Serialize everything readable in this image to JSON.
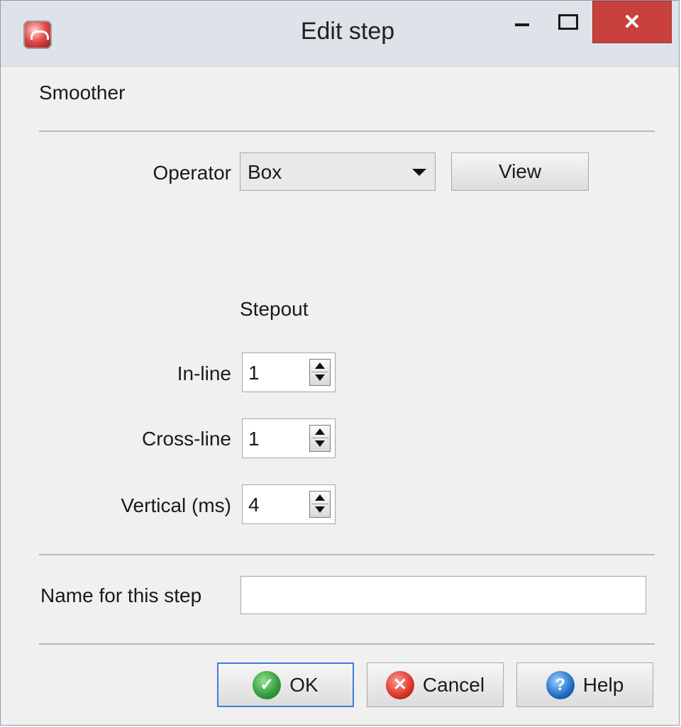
{
  "window": {
    "title": "Edit step",
    "close_glyph": "✕",
    "icons": {
      "app": "app-icon",
      "minimize": "minimize-icon",
      "maximize": "maximize-icon",
      "close": "close-icon"
    }
  },
  "section": {
    "title": "Smoother"
  },
  "operator": {
    "label": "Operator",
    "selected": "Box",
    "view_button": "View"
  },
  "stepout": {
    "title": "Stepout",
    "fields": [
      {
        "label": "In-line",
        "value": "1"
      },
      {
        "label": "Cross-line",
        "value": "1"
      },
      {
        "label": "Vertical (ms)",
        "value": "4"
      }
    ]
  },
  "name_field": {
    "label": "Name for this step",
    "value": ""
  },
  "buttons": {
    "ok": "OK",
    "cancel": "Cancel",
    "help": "Help",
    "ok_glyph": "✓",
    "cancel_glyph": "✕",
    "help_glyph": "?"
  },
  "colors": {
    "close_button": "#c9413d",
    "ok_icon": "#2f9a39",
    "cancel_icon": "#d9342b",
    "help_icon": "#1d6cc7",
    "focused_button_border": "#3c7fd8"
  }
}
